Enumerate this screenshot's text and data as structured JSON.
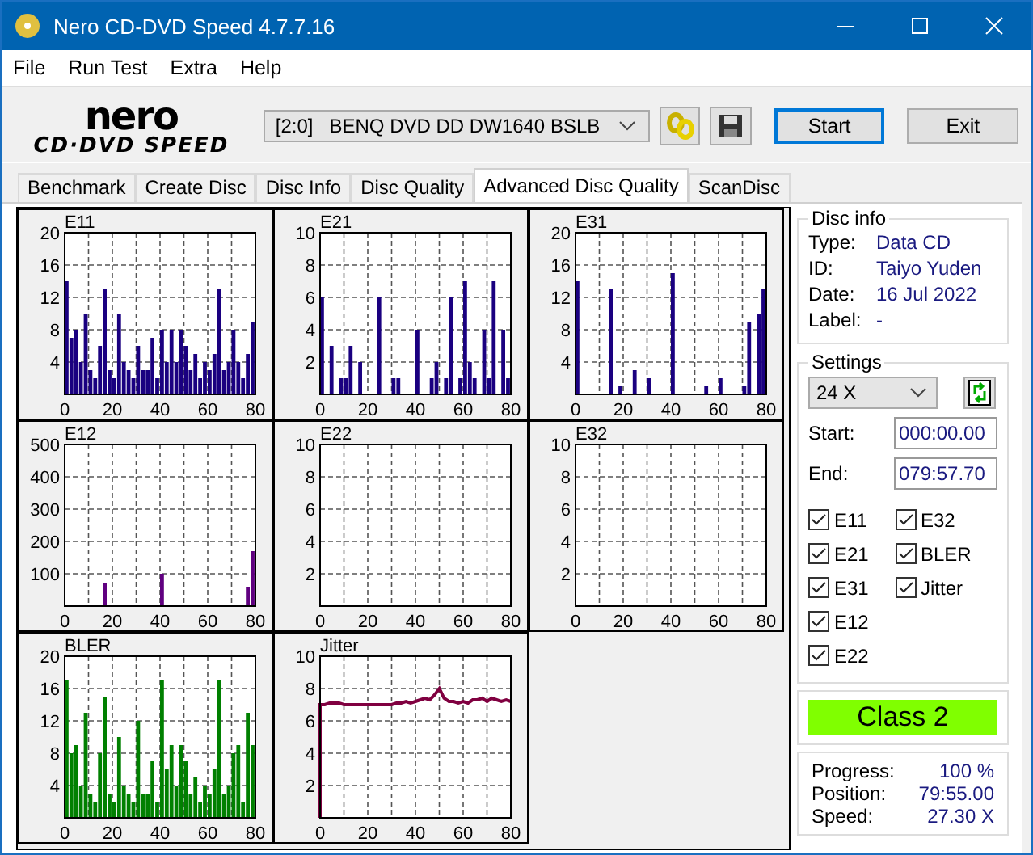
{
  "window": {
    "title": "Nero CD-DVD Speed 4.7.7.16"
  },
  "menu": [
    "File",
    "Run Test",
    "Extra",
    "Help"
  ],
  "logo": {
    "top": "nero",
    "bottom": "CD·DVD SPEED"
  },
  "toolbar": {
    "drive": "[2:0]   BENQ DVD DD DW1640 BSLB",
    "buttons": [
      {
        "label": "Start",
        "selected": true
      },
      {
        "label": "Exit",
        "selected": false
      }
    ]
  },
  "tabs": [
    {
      "label": "Benchmark",
      "selected": false
    },
    {
      "label": "Create Disc",
      "selected": false
    },
    {
      "label": "Disc Info",
      "selected": false
    },
    {
      "label": "Disc Quality",
      "selected": false
    },
    {
      "label": "Advanced Disc Quality",
      "selected": true
    },
    {
      "label": "ScanDisc",
      "selected": false
    }
  ],
  "charts": [
    {
      "chart_data": {
        "type": "bar",
        "title": "E11",
        "grid": true,
        "x": [
          0,
          2,
          4,
          6,
          8,
          10,
          12,
          14,
          16,
          18,
          20,
          22,
          24,
          26,
          28,
          30,
          32,
          34,
          36,
          38,
          40,
          42,
          44,
          46,
          48,
          50,
          52,
          54,
          56,
          58,
          60,
          62,
          64,
          66,
          68,
          70,
          72,
          74,
          76,
          78
        ],
        "xlim": [
          0,
          80
        ],
        "ylim": [
          0,
          20
        ],
        "xticks": [
          0,
          20,
          40,
          60,
          80
        ],
        "yticks": [
          4,
          8,
          12,
          16,
          20
        ],
        "series": [
          {
            "color": "#1a0080",
            "values": [
              14,
              7,
              8,
              4,
              10,
              3,
              2,
              6,
              13,
              3,
              2,
              10,
              4,
              3,
              2,
              6,
              3,
              3,
              7,
              2,
              8,
              4,
              8,
              4,
              8,
              6,
              3,
              5,
              2,
              4,
              3,
              5,
              13,
              3,
              4,
              8,
              4,
              2,
              5,
              9
            ]
          }
        ]
      }
    },
    {
      "chart_data": {
        "type": "bar",
        "title": "E21",
        "grid": true,
        "x": [
          0,
          2,
          4,
          6,
          8,
          10,
          12,
          14,
          16,
          18,
          20,
          22,
          24,
          26,
          28,
          30,
          32,
          34,
          36,
          38,
          40,
          42,
          44,
          46,
          48,
          50,
          52,
          54,
          56,
          58,
          60,
          62,
          64,
          66,
          68,
          70,
          72,
          74,
          76,
          78
        ],
        "xlim": [
          0,
          80
        ],
        "ylim": [
          0,
          10
        ],
        "xticks": [
          0,
          20,
          40,
          60,
          80
        ],
        "yticks": [
          2,
          4,
          6,
          8,
          10
        ],
        "series": [
          {
            "color": "#1a0080",
            "values": [
              6,
              0,
              3,
              0,
              1,
              1,
              3,
              0,
              2,
              0,
              0,
              0,
              6,
              0,
              0,
              1,
              1,
              0,
              0,
              0,
              4,
              0,
              0,
              1,
              2,
              0,
              1,
              6,
              0,
              1,
              7,
              2,
              1,
              0,
              4,
              1,
              7,
              0,
              4,
              1
            ]
          }
        ]
      }
    },
    {
      "chart_data": {
        "type": "bar",
        "title": "E31",
        "grid": true,
        "x": [
          0,
          2,
          4,
          6,
          8,
          10,
          12,
          14,
          16,
          18,
          20,
          22,
          24,
          26,
          28,
          30,
          32,
          34,
          36,
          38,
          40,
          42,
          44,
          46,
          48,
          50,
          52,
          54,
          56,
          58,
          60,
          62,
          64,
          66,
          68,
          70,
          72,
          74,
          76,
          78
        ],
        "xlim": [
          0,
          80
        ],
        "ylim": [
          0,
          20
        ],
        "xticks": [
          0,
          20,
          40,
          60,
          80
        ],
        "yticks": [
          4,
          8,
          12,
          16,
          20
        ],
        "series": [
          {
            "color": "#1a0080",
            "values": [
              14,
              0,
              0,
              0,
              0,
              0,
              0,
              13,
              0,
              1,
              0,
              0,
              3,
              0,
              0,
              2,
              0,
              0,
              0,
              0,
              15,
              0,
              0,
              0,
              0,
              0,
              0,
              1,
              0,
              0,
              2,
              0,
              0,
              0,
              0,
              1,
              9,
              0,
              10,
              13
            ]
          }
        ]
      }
    },
    {
      "chart_data": {
        "type": "bar",
        "title": "E12",
        "grid": true,
        "x": [
          0,
          2,
          4,
          6,
          8,
          10,
          12,
          14,
          16,
          18,
          20,
          22,
          24,
          26,
          28,
          30,
          32,
          34,
          36,
          38,
          40,
          42,
          44,
          46,
          48,
          50,
          52,
          54,
          56,
          58,
          60,
          62,
          64,
          66,
          68,
          70,
          72,
          74,
          76,
          78
        ],
        "xlim": [
          0,
          80
        ],
        "ylim": [
          0,
          500
        ],
        "xticks": [
          0,
          20,
          40,
          60,
          80
        ],
        "yticks": [
          100,
          200,
          300,
          400,
          500
        ],
        "series": [
          {
            "color": "#600080",
            "values": [
              0,
              0,
              0,
              0,
              0,
              0,
              0,
              0,
              70,
              0,
              0,
              0,
              0,
              0,
              0,
              0,
              0,
              0,
              0,
              0,
              100,
              0,
              0,
              0,
              0,
              0,
              0,
              0,
              0,
              0,
              0,
              0,
              0,
              0,
              0,
              0,
              0,
              0,
              60,
              170
            ]
          }
        ]
      }
    },
    {
      "chart_data": {
        "type": "bar",
        "title": "E22",
        "grid": true,
        "x": [
          0,
          2,
          4,
          6,
          8,
          10,
          12,
          14,
          16,
          18,
          20,
          22,
          24,
          26,
          28,
          30,
          32,
          34,
          36,
          38,
          40,
          42,
          44,
          46,
          48,
          50,
          52,
          54,
          56,
          58,
          60,
          62,
          64,
          66,
          68,
          70,
          72,
          74,
          76,
          78
        ],
        "xlim": [
          0,
          80
        ],
        "ylim": [
          0,
          10
        ],
        "xticks": [
          0,
          20,
          40,
          60,
          80
        ],
        "yticks": [
          2,
          4,
          6,
          8,
          10
        ],
        "series": [
          {
            "values": [
              0,
              0,
              0,
              0,
              0,
              0,
              0,
              0,
              0,
              0,
              0,
              0,
              0,
              0,
              0,
              0,
              0,
              0,
              0,
              0,
              0,
              0,
              0,
              0,
              0,
              0,
              0,
              0,
              0,
              0,
              0,
              0,
              0,
              0,
              0,
              0,
              0,
              0,
              0,
              0
            ]
          }
        ]
      }
    },
    {
      "chart_data": {
        "type": "bar",
        "title": "E32",
        "grid": true,
        "x": [
          0,
          2,
          4,
          6,
          8,
          10,
          12,
          14,
          16,
          18,
          20,
          22,
          24,
          26,
          28,
          30,
          32,
          34,
          36,
          38,
          40,
          42,
          44,
          46,
          48,
          50,
          52,
          54,
          56,
          58,
          60,
          62,
          64,
          66,
          68,
          70,
          72,
          74,
          76,
          78
        ],
        "xlim": [
          0,
          80
        ],
        "ylim": [
          0,
          10
        ],
        "xticks": [
          0,
          20,
          40,
          60,
          80
        ],
        "yticks": [
          2,
          4,
          6,
          8,
          10
        ],
        "series": [
          {
            "values": [
              0,
              0,
              0,
              0,
              0,
              0,
              0,
              0,
              0,
              0,
              0,
              0,
              0,
              0,
              0,
              0,
              0,
              0,
              0,
              0,
              0,
              0,
              0,
              0,
              0,
              0,
              0,
              0,
              0,
              0,
              0,
              0,
              0,
              0,
              0,
              0,
              0,
              0,
              0,
              0
            ]
          }
        ]
      }
    },
    {
      "chart_data": {
        "type": "bar",
        "title": "BLER",
        "grid": true,
        "x": [
          0,
          2,
          4,
          6,
          8,
          10,
          12,
          14,
          16,
          18,
          20,
          22,
          24,
          26,
          28,
          30,
          32,
          34,
          36,
          38,
          40,
          42,
          44,
          46,
          48,
          50,
          52,
          54,
          56,
          58,
          60,
          62,
          64,
          66,
          68,
          70,
          72,
          74,
          76,
          78
        ],
        "xlim": [
          0,
          80
        ],
        "ylim": [
          0,
          20
        ],
        "xticks": [
          0,
          20,
          40,
          60,
          80
        ],
        "yticks": [
          4,
          8,
          12,
          16,
          20
        ],
        "series": [
          {
            "color": "#008000",
            "values": [
              17,
              8,
              9,
              4,
              13,
              3,
              2,
              8,
              15,
              3,
              2,
              10,
              4,
              3,
              2,
              12,
              3,
              3,
              7,
              2,
              17,
              6,
              9,
              4,
              9,
              7,
              3,
              5,
              2,
              4,
              3,
              6,
              17,
              3,
              4,
              8,
              9,
              2,
              13,
              9
            ]
          }
        ]
      }
    },
    {
      "chart_data": {
        "type": "line",
        "title": "Jitter",
        "grid": true,
        "x": [
          0,
          0,
          2,
          4,
          6,
          8,
          10,
          12,
          14,
          16,
          18,
          20,
          22,
          24,
          26,
          28,
          30,
          32,
          34,
          36,
          38,
          40,
          42,
          44,
          46,
          48,
          50,
          52,
          54,
          56,
          58,
          60,
          62,
          64,
          66,
          68,
          70,
          72,
          74,
          76,
          78,
          80
        ],
        "xlim": [
          0,
          80
        ],
        "ylim": [
          0,
          10
        ],
        "xticks": [
          0,
          20,
          40,
          60,
          80
        ],
        "yticks": [
          2,
          4,
          6,
          8,
          10
        ],
        "series": [
          {
            "color": "#800040",
            "values": [
              0,
              7,
              7,
              7.1,
              7.1,
              7.1,
              7,
              7,
              7,
              7,
              7,
              7,
              7,
              7,
              7,
              7,
              7,
              7.1,
              7.1,
              7.2,
              7.1,
              7.2,
              7.3,
              7.4,
              7.3,
              7.6,
              8,
              7.4,
              7.2,
              7.2,
              7.1,
              7.2,
              7.1,
              7.3,
              7.3,
              7.4,
              7.2,
              7.4,
              7.3,
              7.2,
              7.3,
              7.2
            ]
          }
        ]
      }
    }
  ],
  "disc_info": {
    "title": "Disc info",
    "rows": [
      {
        "label": "Type:",
        "value": "Data CD"
      },
      {
        "label": "ID:",
        "value": "Taiyo Yuden"
      },
      {
        "label": "Date:",
        "value": "16 Jul 2022"
      },
      {
        "label": "Label:",
        "value": "-"
      }
    ]
  },
  "settings": {
    "title": "Settings",
    "speed": "24 X",
    "start_label": "Start:",
    "start": "000:00.00",
    "end_label": "End:",
    "end": "079:57.70",
    "checks": [
      {
        "label": "E11",
        "checked": true
      },
      {
        "label": "E21",
        "checked": true
      },
      {
        "label": "E31",
        "checked": true
      },
      {
        "label": "E12",
        "checked": true
      },
      {
        "label": "E22",
        "checked": true
      },
      {
        "label": "E32",
        "checked": true
      },
      {
        "label": "BLER",
        "checked": true
      },
      {
        "label": "Jitter",
        "checked": true
      }
    ]
  },
  "result": {
    "label": "Class 2",
    "color": "#80ff00"
  },
  "progress": [
    {
      "label": "Progress:",
      "value": "100 %"
    },
    {
      "label": "Position:",
      "value": "79:55.00"
    },
    {
      "label": "Speed:",
      "value": "27.30 X"
    }
  ]
}
